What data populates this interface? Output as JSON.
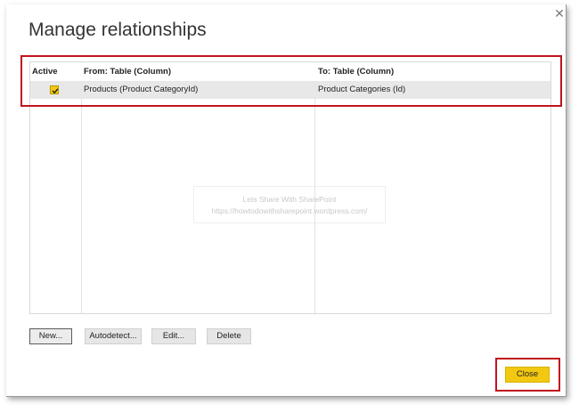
{
  "dialog": {
    "title": "Manage relationships",
    "close_icon": "close-icon"
  },
  "table": {
    "headers": [
      "Active",
      "From: Table (Column)",
      "To: Table (Column)"
    ],
    "rows": [
      {
        "active": true,
        "from": "Products (Product CategoryId)",
        "to": "Product Categories (Id)"
      }
    ]
  },
  "watermark": {
    "line1": "Lets Share With SharePoint",
    "line2": "https://howtodowithsharepoint.wordpress.com/"
  },
  "buttons": {
    "new": "New...",
    "autodetect": "Autodetect...",
    "edit": "Edit...",
    "delete": "Delete",
    "close": "Close"
  },
  "colors": {
    "accent": "#f2c811",
    "highlight": "#c0141c"
  }
}
